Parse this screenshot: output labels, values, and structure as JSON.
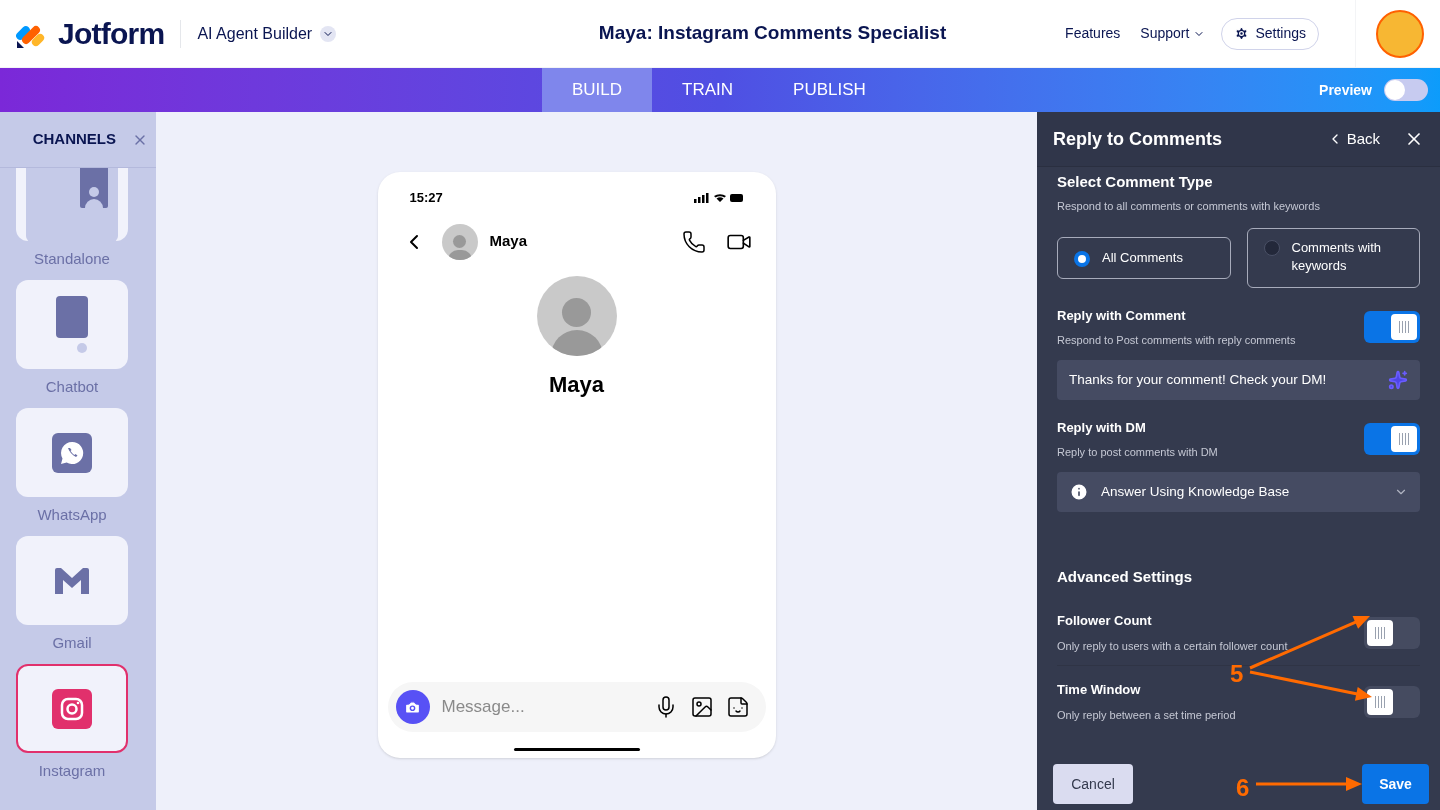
{
  "header": {
    "brand": "Jotform",
    "product": "AI Agent Builder",
    "title": "Maya: Instagram Comments Specialist",
    "nav": [
      {
        "label": "Features",
        "kind": "link"
      },
      {
        "label": "Support",
        "kind": "menu"
      }
    ],
    "settings_button": "Settings"
  },
  "tabs": [
    {
      "label": "BUILD",
      "selected": true
    },
    {
      "label": "TRAIN",
      "selected": false
    },
    {
      "label": "PUBLISH",
      "selected": false
    }
  ],
  "preview": {
    "label": "Preview",
    "on": false
  },
  "sidebar": {
    "title": "CHANNELS",
    "items": [
      {
        "label": "Standalone",
        "kind": "standalone",
        "selected": false
      },
      {
        "label": "Chatbot",
        "kind": "chatbot",
        "selected": false
      },
      {
        "label": "WhatsApp",
        "kind": "whatsapp",
        "selected": false
      },
      {
        "label": "Gmail",
        "kind": "gmail",
        "selected": false
      },
      {
        "label": "Instagram",
        "kind": "instagram",
        "selected": true
      }
    ]
  },
  "phone": {
    "time": "15:27",
    "contact": "Maya",
    "profile_name": "Maya",
    "message_placeholder": "Message..."
  },
  "panel": {
    "title": "Reply to Comments",
    "back": "Back",
    "comment_type": {
      "title": "Select Comment Type",
      "description": "Respond to all comments or comments with keywords",
      "options": [
        {
          "label": "All Comments",
          "selected": true
        },
        {
          "label": "Comments with keywords",
          "selected": false
        }
      ]
    },
    "settings": [
      {
        "kind": "toggle",
        "title": "Reply with Comment",
        "description": "Respond to Post comments with reply comments",
        "on": true
      },
      {
        "kind": "text",
        "value": "Thanks for your comment! Check your DM!"
      },
      {
        "kind": "toggle",
        "title": "Reply with DM",
        "description": "Reply to post comments with DM",
        "on": true
      },
      {
        "kind": "select",
        "value": "Answer Using Knowledge Base"
      }
    ],
    "advanced": {
      "title": "Advanced Settings",
      "items": [
        {
          "title": "Follower Count",
          "description": "Only reply to users with a certain follower count",
          "on": false
        },
        {
          "title": "Time Window",
          "description": "Only reply between a set time period",
          "on": false
        }
      ]
    },
    "cancel": "Cancel",
    "save": "Save"
  },
  "annotations": [
    {
      "label": "5"
    },
    {
      "label": "6"
    }
  ]
}
